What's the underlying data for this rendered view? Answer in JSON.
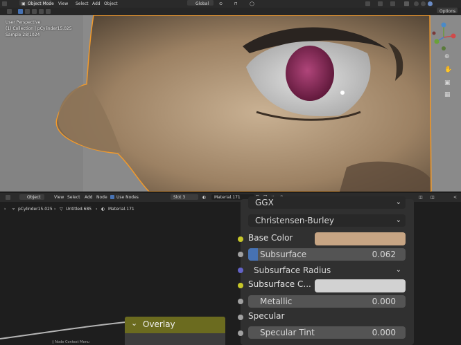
{
  "top_header": {
    "mode": "Object Mode",
    "menus": [
      "View",
      "Select",
      "Add",
      "Object"
    ],
    "transform_orientation": "Global",
    "options_label": "Options"
  },
  "viewport": {
    "overlay_lines": [
      "User Perspective",
      "(1) Collection | pCylinder15.025",
      "Sample 28/1024"
    ]
  },
  "node_header": {
    "editor_type": "Object",
    "menus": [
      "View",
      "Select",
      "Add",
      "Node"
    ],
    "use_nodes_label": "Use Nodes",
    "slot": "Slot 3",
    "material": "Material.171"
  },
  "breadcrumb": [
    "pCylinder15.025",
    "Untitled.685",
    "Material.171"
  ],
  "node_panel": {
    "distribution": "GGX",
    "subsurface_method": "Christensen-Burley",
    "base_color_label": "Base Color",
    "base_color": "#c7a584",
    "subsurface_label": "Subsurface",
    "subsurface_value": "0.062",
    "subsurface_fraction": 0.062,
    "subsurface_radius_label": "Subsurface Radius",
    "subsurface_color_label": "Subsurface C...",
    "subsurface_color": "#d2d2d2",
    "metallic_label": "Metallic",
    "metallic_value": "0.000",
    "specular_label": "Specular",
    "specular_tint_label": "Specular Tint",
    "specular_tint_value": "0.000"
  },
  "overlay_frame": {
    "label": "Overlay"
  },
  "status_bar": {
    "hint": "Node Context Menu"
  },
  "colors": {
    "yellow_socket": "#c7c729",
    "grey_socket": "#a1a1a1",
    "purple_socket": "#6363c7",
    "slider_fill": "#4772b3",
    "frame_color": "#6b6b1f"
  }
}
